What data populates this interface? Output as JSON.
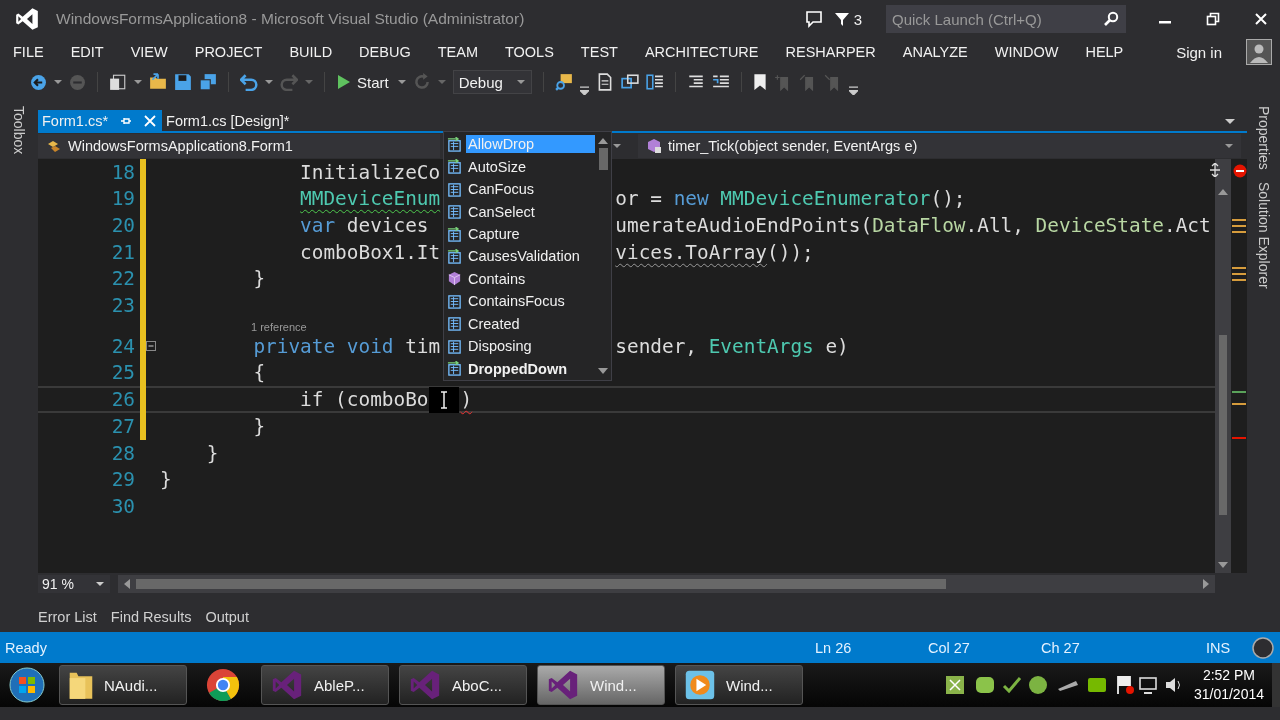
{
  "window": {
    "title": "WindowsFormsApplication8 - Microsoft Visual Studio (Administrator)",
    "notification_count": "3",
    "quick_launch": {
      "placeholder": "Quick Launch (Ctrl+Q)"
    }
  },
  "menu": [
    "FILE",
    "EDIT",
    "VIEW",
    "PROJECT",
    "BUILD",
    "DEBUG",
    "TEAM",
    "TOOLS",
    "TEST",
    "ARCHITECTURE",
    "RESHARPER",
    "ANALYZE",
    "WINDOW",
    "HELP"
  ],
  "sign_in": "Sign in",
  "toolbar": {
    "start": "Start",
    "configuration": "Debug"
  },
  "side_panels": {
    "left": [
      "Toolbox"
    ],
    "right": [
      "Properties",
      "Solution Explorer"
    ]
  },
  "document_tabs": [
    {
      "label": "Form1.cs*",
      "selected": true
    },
    {
      "label": "Form1.cs [Design]*",
      "selected": false
    }
  ],
  "navigation": {
    "class": "WindowsFormsApplication8.Form1",
    "member": "timer_Tick(object sender, EventArgs e)"
  },
  "editor": {
    "lines": [
      {
        "number": "18",
        "current": false,
        "left": [
          {
            "text": "            InitializeCo",
            "kind": "plain"
          }
        ]
      },
      {
        "number": "19",
        "current": false,
        "left": [
          {
            "text": "            MMDeviceEnum",
            "kind": "type",
            "warning": true
          }
        ],
        "right": [
          {
            "text": "or = ",
            "kind": "plain"
          },
          {
            "text": "new ",
            "kind": "keyword"
          },
          {
            "text": "MMDeviceEnumerator",
            "kind": "type"
          },
          {
            "text": "();",
            "kind": "plain"
          }
        ]
      },
      {
        "number": "20",
        "current": false,
        "left": [
          {
            "text": "            var ",
            "kind": "keyword"
          },
          {
            "text": "devices",
            "kind": "plain"
          }
        ],
        "right": [
          {
            "text": "umerateAudioEndPoints(",
            "kind": "plain"
          },
          {
            "text": "DataFlow",
            "kind": "enum"
          },
          {
            "text": ".All, ",
            "kind": "plain"
          },
          {
            "text": "DeviceState",
            "kind": "enum"
          },
          {
            "text": ".Act",
            "kind": "plain"
          }
        ]
      },
      {
        "number": "21",
        "current": false,
        "left": [
          {
            "text": "            comboBox1.It",
            "kind": "plain"
          }
        ],
        "right": [
          {
            "text": "vices.ToArray",
            "kind": "plain",
            "suggestion": true
          },
          {
            "text": "());",
            "kind": "plain"
          }
        ]
      },
      {
        "number": "22",
        "current": false,
        "left": [
          {
            "text": "        }",
            "kind": "plain"
          }
        ]
      },
      {
        "number": "23",
        "current": false
      },
      {
        "number": "24",
        "current": false,
        "codelens": "1 reference",
        "left": [
          {
            "text": "        private ",
            "kind": "keyword"
          },
          {
            "text": "void ",
            "kind": "keyword"
          },
          {
            "text": "tim",
            "kind": "plain"
          }
        ],
        "right": [
          {
            "text": "sender, ",
            "kind": "plain"
          },
          {
            "text": "EventArgs",
            "kind": "type"
          },
          {
            "text": " e)",
            "kind": "plain"
          }
        ]
      },
      {
        "number": "25",
        "current": false,
        "left": [
          {
            "text": "        {",
            "kind": "plain"
          }
        ]
      },
      {
        "number": "26",
        "current": true,
        "left": [
          {
            "text": "            if (comboBo",
            "kind": "plain"
          },
          {
            "kind": "caret"
          },
          {
            "text": ")",
            "kind": "plain",
            "error": true
          }
        ]
      },
      {
        "number": "27",
        "current": false,
        "left": [
          {
            "text": "        }",
            "kind": "plain"
          }
        ]
      },
      {
        "number": "28",
        "current": false,
        "left": [
          {
            "text": "    }",
            "kind": "plain"
          }
        ]
      },
      {
        "number": "29",
        "current": false,
        "left": [
          {
            "text": "}",
            "kind": "plain"
          }
        ]
      },
      {
        "number": "30",
        "current": false
      }
    ],
    "completion": [
      {
        "label": "AllowDrop",
        "kind": "event",
        "selected": true,
        "bold": false
      },
      {
        "label": "AutoSize",
        "kind": "event",
        "selected": false,
        "bold": false
      },
      {
        "label": "CanFocus",
        "kind": "property",
        "selected": false,
        "bold": false
      },
      {
        "label": "CanSelect",
        "kind": "property",
        "selected": false,
        "bold": false
      },
      {
        "label": "Capture",
        "kind": "event",
        "selected": false,
        "bold": false
      },
      {
        "label": "CausesValidation",
        "kind": "event",
        "selected": false,
        "bold": false
      },
      {
        "label": "Contains",
        "kind": "method",
        "selected": false,
        "bold": false
      },
      {
        "label": "ContainsFocus",
        "kind": "property",
        "selected": false,
        "bold": false
      },
      {
        "label": "Created",
        "kind": "property",
        "selected": false,
        "bold": false
      },
      {
        "label": "Disposing",
        "kind": "property",
        "selected": false,
        "bold": false
      },
      {
        "label": "DroppedDown",
        "kind": "event",
        "selected": false,
        "bold": true
      }
    ]
  },
  "zoom": "91 %",
  "tool_tabs": [
    "Error List",
    "Find Results",
    "Output"
  ],
  "status_bar": {
    "message": "Ready",
    "line": "Ln 26",
    "column": "Col 27",
    "char": "Ch 27",
    "mode": "INS"
  },
  "taskbar": {
    "items": [
      {
        "kind": "folder",
        "label": "NAudi...",
        "selected": false
      },
      {
        "kind": "chrome",
        "selected": false
      },
      {
        "kind": "vs",
        "label": "AbleP...",
        "selected": false
      },
      {
        "kind": "vs",
        "label": "AboC...",
        "selected": false
      },
      {
        "kind": "vs",
        "label": "Wind...",
        "selected": true
      },
      {
        "kind": "media",
        "label": "Wind...",
        "selected": false
      }
    ],
    "clock": {
      "time": "2:52 PM",
      "date": "31/01/2014"
    }
  }
}
